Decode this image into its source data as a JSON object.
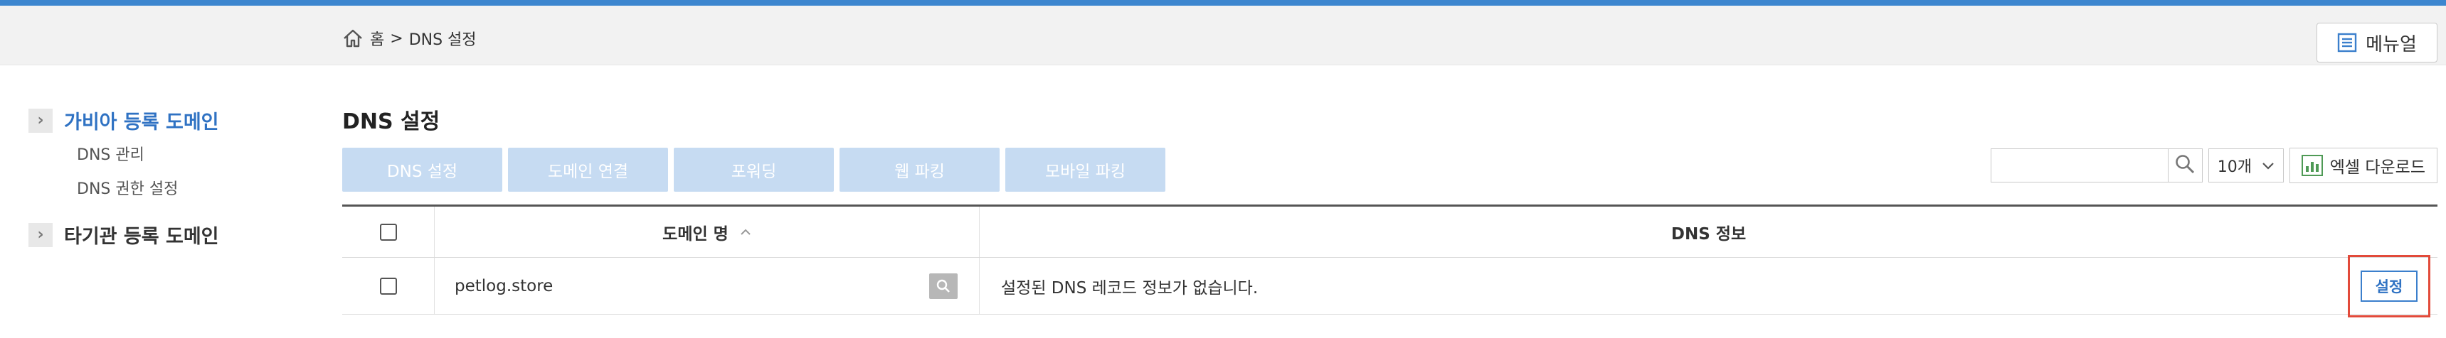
{
  "breadcrumb": {
    "home": "홈",
    "separator": ">",
    "current": "DNS 설정"
  },
  "header": {
    "menu_label": "메뉴얼"
  },
  "sidebar": {
    "groups": [
      {
        "label": "가비아 등록 도메인",
        "items": [
          "DNS 관리",
          "DNS 권한 설정"
        ]
      },
      {
        "label": "타기관 등록 도메인"
      }
    ]
  },
  "page": {
    "title": "DNS 설정"
  },
  "actions": {
    "tabs": [
      "DNS 설정",
      "도메인 연결",
      "포워딩",
      "웹 파킹",
      "모바일 파킹"
    ]
  },
  "tools": {
    "search_value": "",
    "count_select": "10개",
    "excel_label": "엑셀 다운로드"
  },
  "table": {
    "headers": {
      "domain": "도메인 명",
      "dns": "DNS 정보"
    },
    "rows": [
      {
        "domain": "petlog.store",
        "dns_info": "설정된 DNS 레코드 정보가 없습니다.",
        "action": "설정"
      }
    ]
  },
  "colors": {
    "accent": "#2f72c3",
    "tab_disabled": "#c6dbf2",
    "highlight": "#e24a3a",
    "top_rule": "#3d86cf"
  }
}
